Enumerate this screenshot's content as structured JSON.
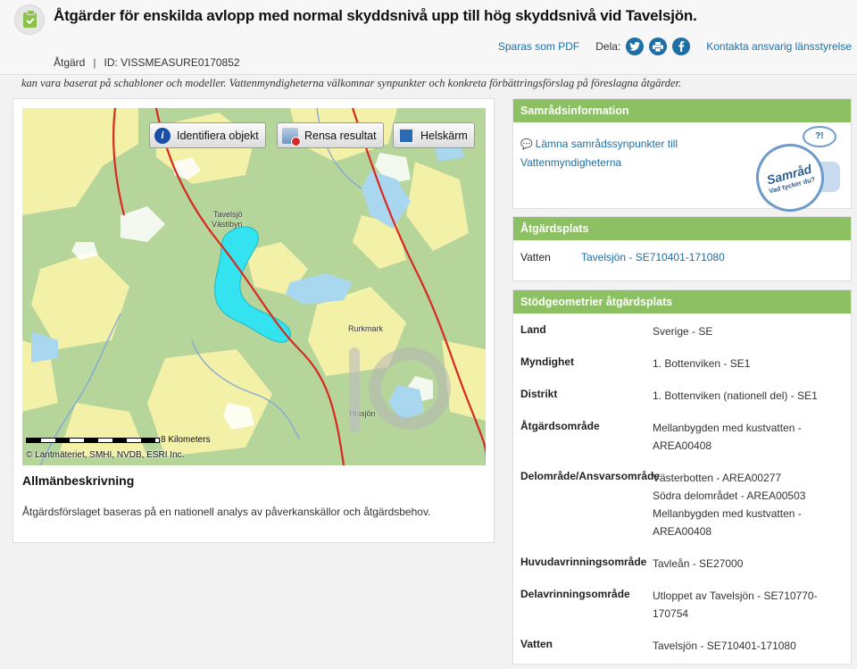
{
  "header": {
    "title": "Åtgärder för enskilda avlopp med normal skyddsnivå upp till hög skyddsnivå vid Tavelsjön.",
    "type_label": "Åtgärd",
    "separator": "|",
    "id_label": "ID: VISSMEASURE0170852",
    "save_pdf": "Sparas som PDF",
    "share_label": "Dela:",
    "contact": "Kontakta ansvarig länsstyrelse"
  },
  "intro_text": "kan vara baserat på schabloner och modeller. Vattenmyndigheterna välkomnar synpunkter och konkreta förbättringsförslag på föreslagna åtgärder.",
  "map": {
    "buttons": {
      "identify": "Identifiera objekt",
      "clear": "Rensa resultat",
      "fullscreen": "Helskärm"
    },
    "place_labels": {
      "tavelsjo": "Tavelsjö",
      "vastibyn": "Västibyn",
      "rurkmark": "Rurkmark",
      "hissjon": "Hissjön"
    },
    "scale_label": "8 Kilometers",
    "copyright": "© Lantmäteriet, SMHI, NVDB, ESRI Inc."
  },
  "description": {
    "title": "Allmänbeskrivning",
    "text": "Åtgärdsförslaget baseras på en nationell analys av påverkanskällor och åtgärdsbehov."
  },
  "consultation": {
    "title": "Samrådsinformation",
    "link": "Lämna samrådssynpunkter till Vattenmyndigheterna",
    "badge_title": "Samråd",
    "badge_subtitle": "Vad tycker du?"
  },
  "location": {
    "title": "Åtgärdsplats",
    "key": "Vatten",
    "value": "Tavelsjön - SE710401-171080"
  },
  "geometry": {
    "title": "Stödgeometrier åtgärdsplats",
    "rows": [
      {
        "key": "Land",
        "lines": [
          "Sverige - SE"
        ]
      },
      {
        "key": "Myndighet",
        "lines": [
          "1. Bottenviken - SE1"
        ]
      },
      {
        "key": "Distrikt",
        "lines": [
          "1. Bottenviken (nationell del) - SE1"
        ]
      },
      {
        "key": "Åtgärdsområde",
        "lines": [
          "Mellanbygden med kustvatten -",
          "AREA00408"
        ]
      },
      {
        "key": "Delområde/Ansvarsområde",
        "lines": [
          "Västerbotten - AREA00277",
          "Södra delområdet - AREA00503",
          "Mellanbygden med kustvatten -",
          "AREA00408"
        ]
      },
      {
        "key": "Huvudavrinningsområde",
        "lines": [
          "Tavleån - SE27000"
        ]
      },
      {
        "key": "Delavrinningsområde",
        "lines": [
          "Utloppet av Tavelsjön - SE710770-",
          "170754"
        ]
      },
      {
        "key": "Vatten",
        "lines": [
          "Tavelsjön - SE710401-171080"
        ]
      }
    ]
  },
  "colors": {
    "accent_green": "#8cc063",
    "link_blue": "#1d6fa5",
    "lake_cyan": "#33e3ef",
    "road_red": "#d8281f"
  }
}
